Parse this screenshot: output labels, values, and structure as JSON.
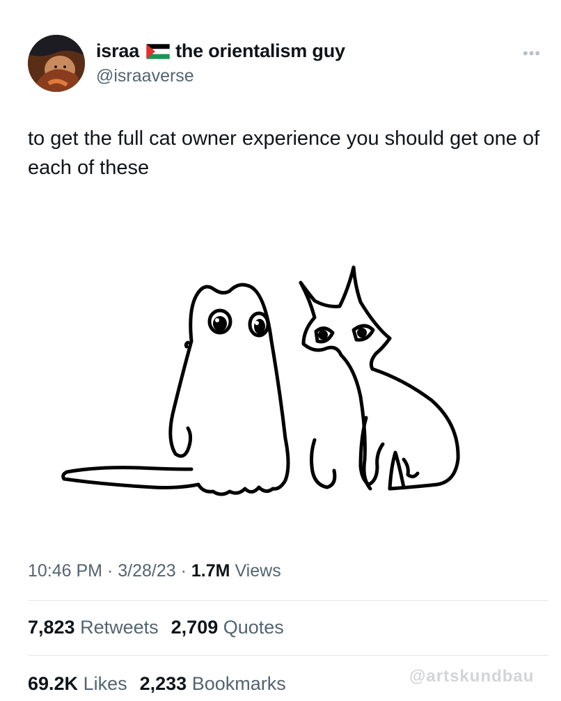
{
  "user": {
    "display_name": "israa",
    "display_name_suffix": "the orientalism guy",
    "handle": "@israaverse",
    "flag_icon": "palestine-flag-icon"
  },
  "menu": {
    "more_icon": "more-dots-icon",
    "more_glyph": "•••"
  },
  "tweet": {
    "text": "to get the full cat owner experience you should get one of each of these",
    "image_icon": "two-cats-doodle"
  },
  "meta": {
    "time": "10:46 PM",
    "separator": "·",
    "date": "3/28/23",
    "views_count": "1.7M",
    "views_label": "Views"
  },
  "stats": {
    "retweets_count": "7,823",
    "retweets_label": "Retweets",
    "quotes_count": "2,709",
    "quotes_label": "Quotes",
    "likes_count": "69.2K",
    "likes_label": "Likes",
    "bookmarks_count": "2,233",
    "bookmarks_label": "Bookmarks"
  },
  "watermark": {
    "text": "@artskundbau"
  },
  "colors": {
    "text_primary": "#0f1419",
    "text_secondary": "#536471",
    "divider": "#e3e6e8",
    "flag_green": "#149954",
    "flag_red": "#e4312b"
  }
}
